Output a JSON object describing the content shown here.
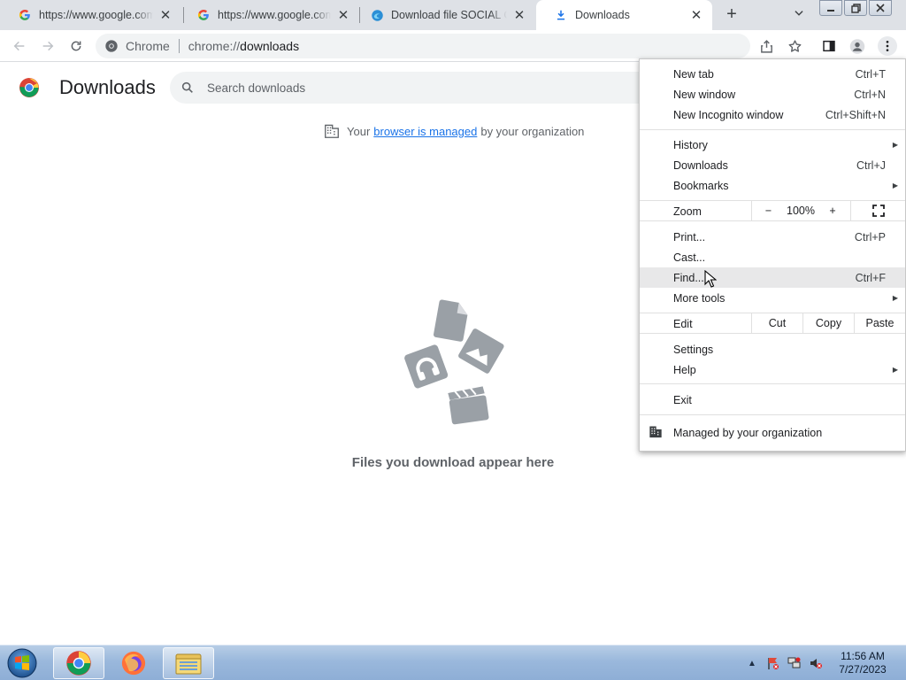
{
  "tabs": [
    {
      "title": "https://www.google.com/",
      "favicon": "google-icon",
      "close": "✕"
    },
    {
      "title": "https://www.google.com/",
      "favicon": "google-icon",
      "close": "✕"
    },
    {
      "title": "Download file SOCIAL CR",
      "favicon": "edge-icon",
      "close": "✕"
    },
    {
      "title": "Downloads",
      "favicon": "download-icon",
      "close": "✕",
      "active": true
    }
  ],
  "newtab_symbol": "+",
  "omnibox": {
    "site_chip": "Chrome",
    "url_scheme": "chrome://",
    "url_host": "downloads"
  },
  "page": {
    "title": "Downloads",
    "search_placeholder": "Search downloads",
    "managed_prefix": "Your",
    "managed_link": "browser is managed",
    "managed_suffix": "by your organization",
    "empty_text": "Files you download appear here"
  },
  "menu": {
    "new_tab": {
      "label": "New tab",
      "shortcut": "Ctrl+T"
    },
    "new_window": {
      "label": "New window",
      "shortcut": "Ctrl+N"
    },
    "incognito": {
      "label": "New Incognito window",
      "shortcut": "Ctrl+Shift+N"
    },
    "history": {
      "label": "History"
    },
    "downloads": {
      "label": "Downloads",
      "shortcut": "Ctrl+J"
    },
    "bookmarks": {
      "label": "Bookmarks"
    },
    "zoom": {
      "label": "Zoom",
      "minus": "−",
      "value": "100%",
      "plus": "+"
    },
    "print": {
      "label": "Print...",
      "shortcut": "Ctrl+P"
    },
    "cast": {
      "label": "Cast..."
    },
    "find": {
      "label": "Find...",
      "shortcut": "Ctrl+F"
    },
    "more_tools": {
      "label": "More tools"
    },
    "edit": {
      "label": "Edit",
      "cut": "Cut",
      "copy": "Copy",
      "paste": "Paste"
    },
    "settings": {
      "label": "Settings"
    },
    "help": {
      "label": "Help"
    },
    "exit": {
      "label": "Exit"
    },
    "managed": {
      "label": "Managed by your organization"
    }
  },
  "taskbar": {
    "time": "11:56 AM",
    "date": "7/27/2023",
    "apps": [
      "chrome-icon",
      "firefox-icon",
      "file-explorer-icon"
    ]
  },
  "colors": {
    "accent": "#1a73e8",
    "tabstrip": "#dee1e6",
    "menu_hover": "#e8e8e9",
    "empty_art": "#9aa0a6"
  }
}
